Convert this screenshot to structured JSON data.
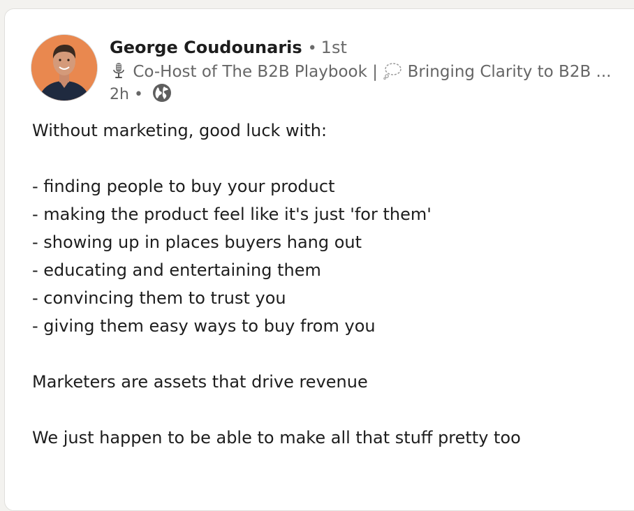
{
  "post": {
    "author": {
      "name": "George Coudounaris",
      "separator": "•",
      "degree": "1st",
      "headline_part1": "Co-Host of The B2B Playbook |",
      "headline_part2": "Bringing Clarity to B2B ...",
      "headline_icon_1": "microphone-icon",
      "headline_icon_2": "thought-bubble-icon",
      "avatar_bg": "#e9884f"
    },
    "meta": {
      "time": "2h",
      "separator": "•",
      "visibility_icon": "globe-icon"
    },
    "body": {
      "intro": "Without marketing, good luck with:",
      "list": [
        "- finding people to buy your product",
        "- making the product feel like it's just 'for them'",
        "- showing up in places buyers hang out",
        "- educating and entertaining them",
        "- convincing them to trust you",
        "- giving them easy ways to buy from you"
      ],
      "paragraph_2": "Marketers are assets that drive revenue",
      "paragraph_3": "We just happen to be able to make all that stuff pretty too"
    }
  }
}
